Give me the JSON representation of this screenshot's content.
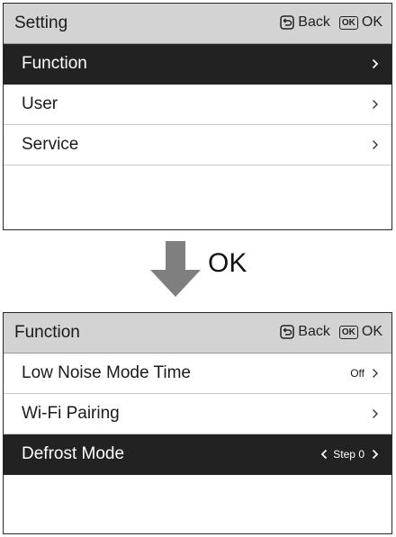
{
  "screen1": {
    "title": "Setting",
    "back_label": "Back",
    "ok_icon_text": "OK",
    "ok_label": "OK",
    "items": [
      {
        "label": "Function",
        "selected": true
      },
      {
        "label": "User",
        "selected": false
      },
      {
        "label": "Service",
        "selected": false
      }
    ]
  },
  "transition": {
    "label": "OK"
  },
  "screen2": {
    "title": "Function",
    "back_label": "Back",
    "ok_icon_text": "OK",
    "ok_label": "OK",
    "items": [
      {
        "label": "Low Noise Mode Time",
        "value": "Off",
        "selected": false
      },
      {
        "label": "Wi-Fi Pairing",
        "value": "",
        "selected": false
      },
      {
        "label": "Defrost Mode",
        "value": "Step 0",
        "selected": true
      }
    ]
  },
  "colors": {
    "header_bg": "#d3d3d3",
    "selected_bg": "#222222",
    "arrow": "#7f7f7f"
  }
}
